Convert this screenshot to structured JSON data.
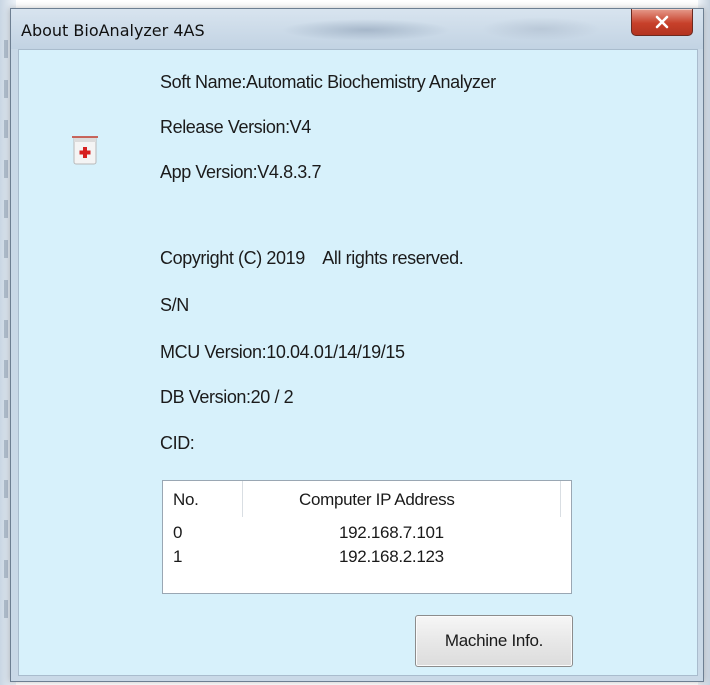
{
  "window": {
    "title": "About BioAnalyzer 4AS"
  },
  "about": {
    "soft_name": "Soft Name:Automatic Biochemistry Analyzer",
    "release_version": "Release Version:V4",
    "app_version": "App Version:V4.8.3.7",
    "copyright": "Copyright (C) 2019    All rights reserved.",
    "sn": "S/N",
    "mcu_version": "MCU Version:10.04.01/14/19/15",
    "db_version": "DB Version:20 / 2",
    "cid": "CID:"
  },
  "ip_table": {
    "headers": [
      "No.",
      "Computer IP Address"
    ],
    "rows": [
      [
        "0",
        "192.168.7.101"
      ],
      [
        "1",
        "192.168.2.123"
      ]
    ]
  },
  "buttons": {
    "machine_info": "Machine Info."
  },
  "icons": {
    "app": "medical-kit-icon",
    "close": "close-icon"
  },
  "colors": {
    "client_bg": "#d7f1fb",
    "close_btn": "#c7402a"
  }
}
